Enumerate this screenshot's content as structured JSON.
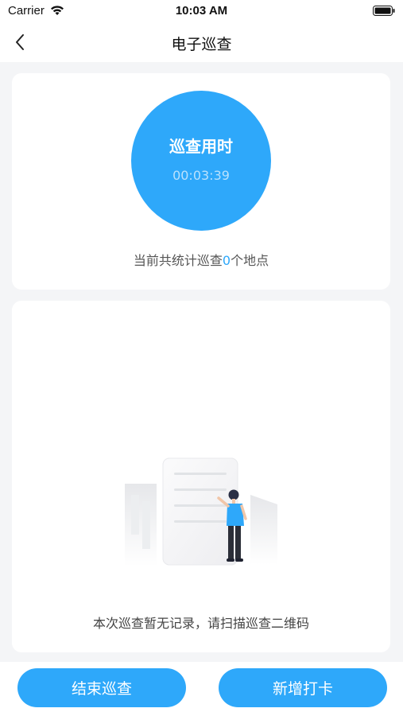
{
  "status_bar": {
    "carrier": "Carrier",
    "time": "10:03 AM"
  },
  "nav": {
    "title": "电子巡查"
  },
  "summary": {
    "timer_label": "巡查用时",
    "timer_value": "00:03:39",
    "count_prefix": "当前共统计巡查",
    "count_value": "0",
    "count_suffix": "个地点"
  },
  "records": {
    "empty_text": "本次巡查暂无记录，请扫描巡查二维码"
  },
  "actions": {
    "end_label": "结束巡查",
    "add_label": "新增打卡"
  },
  "colors": {
    "accent": "#2ea8fa",
    "background": "#f4f5f7"
  },
  "icons": {
    "back": "chevron-left-icon",
    "wifi": "wifi-icon",
    "battery": "battery-icon"
  }
}
